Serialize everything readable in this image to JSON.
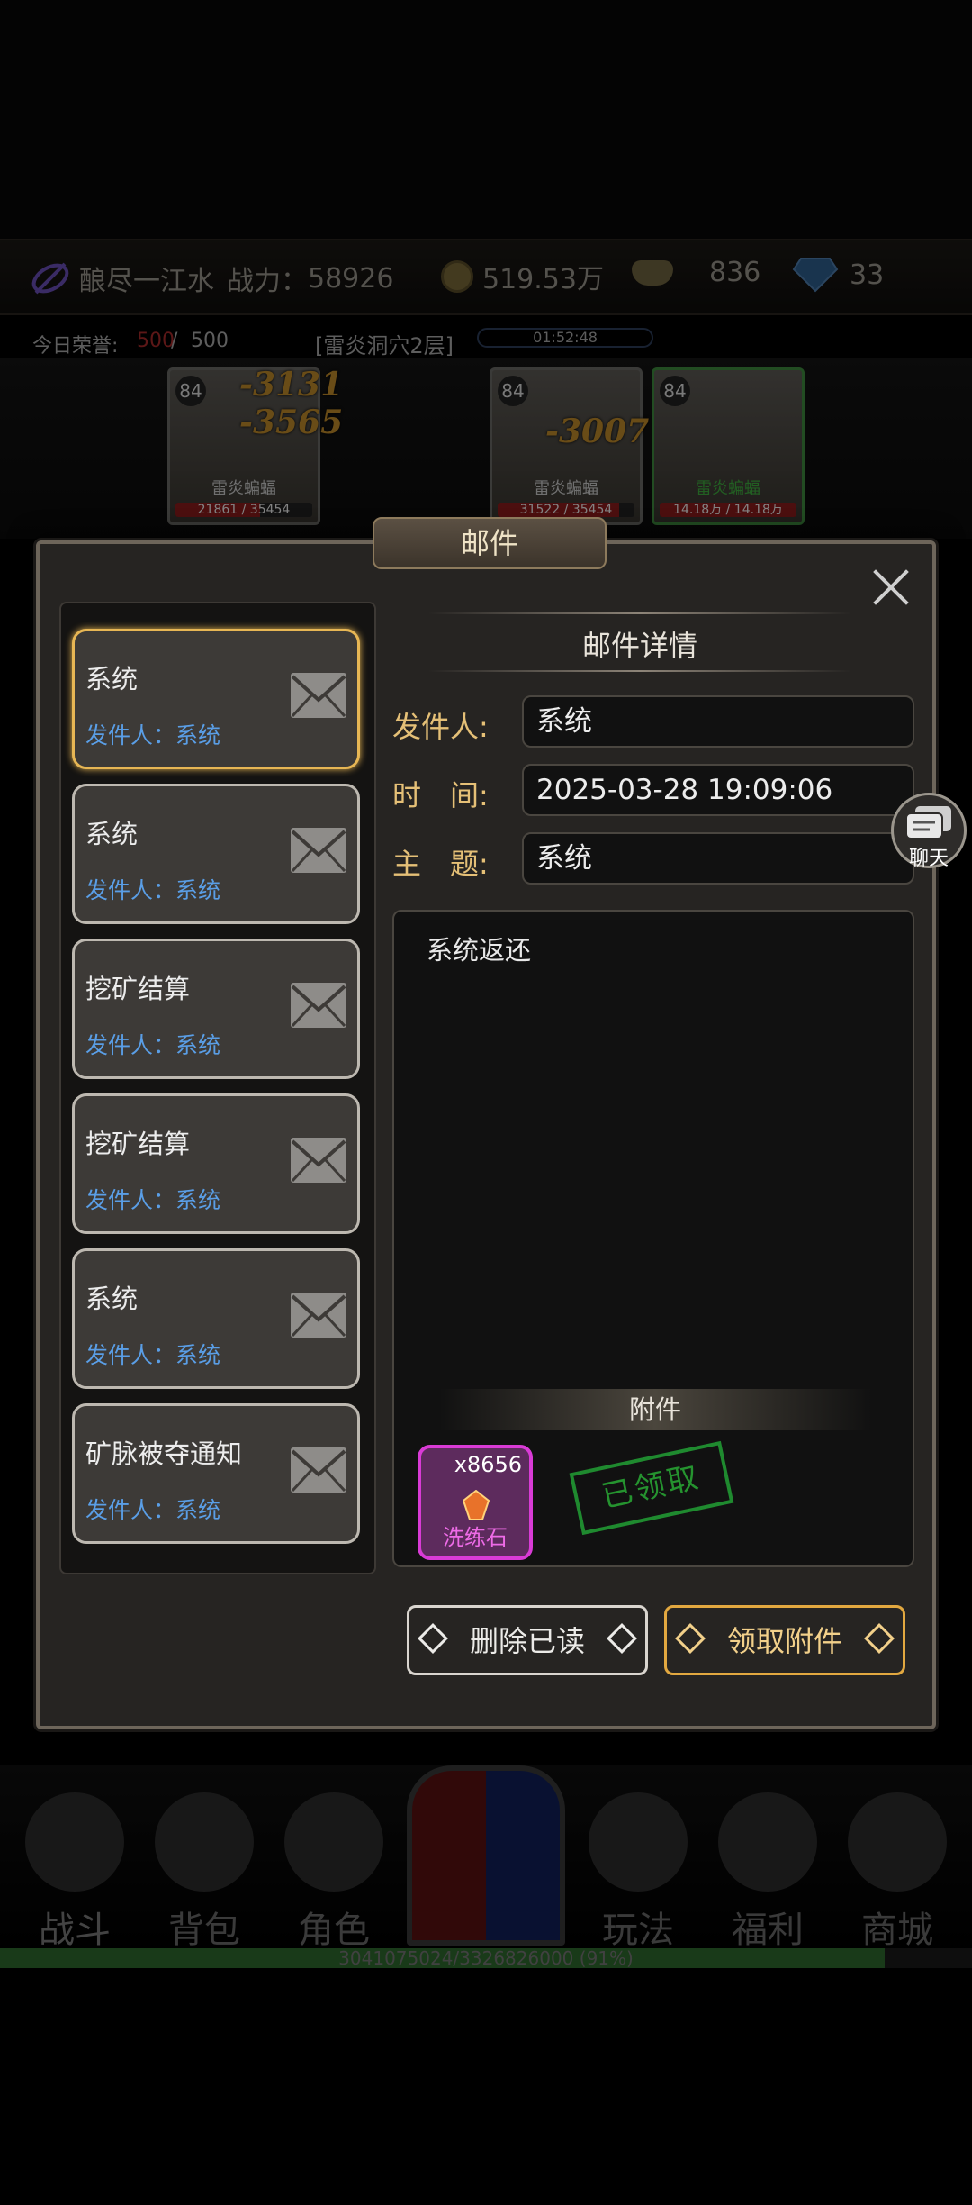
{
  "topbar": {
    "player_name": "酿尽一江水",
    "power_label": "战力：",
    "power_value": "58926",
    "gold": "519.53万",
    "ingot": "836",
    "diamond": "33"
  },
  "honor": {
    "label": "今日荣誉:",
    "current": "500",
    "sep": " / ",
    "max": "500",
    "location": "[雷炎洞穴2层]",
    "timer": "01:52:48"
  },
  "monsters": [
    {
      "level": "84",
      "name": "雷炎蝙蝠",
      "hp": "21861 / 35454",
      "hp_ratio": 0.62
    },
    {
      "level": "84",
      "name": "雷炎蝙蝠",
      "hp": "31522 / 35454",
      "hp_ratio": 0.89
    },
    {
      "level": "84",
      "name": "雷炎蝙蝠",
      "hp": "14.18万 / 14.18万",
      "hp_ratio": 1.0
    }
  ],
  "damage_numbers": [
    "-3131",
    "-3565",
    "-3007"
  ],
  "dialog": {
    "title": "邮件",
    "detail_title": "邮件详情",
    "fields": {
      "sender_label": "发件人:",
      "sender_value": "系统",
      "time_label": "时　间:",
      "time_value": "2025-03-28 19:09:06",
      "subject_label": "主　题:",
      "subject_value": "系统"
    },
    "content": "系统返还",
    "attachment_header": "附件",
    "attachment": {
      "count": "x8656",
      "name": "洗练石"
    },
    "stamp": "已领取",
    "delete_read_label": "删除已读",
    "claim_label": "领取附件"
  },
  "mail_list": [
    {
      "title": "系统",
      "sender": "发件人：系统",
      "selected": true
    },
    {
      "title": "系统",
      "sender": "发件人：系统",
      "selected": false
    },
    {
      "title": "挖矿结算",
      "sender": "发件人：系统",
      "selected": false
    },
    {
      "title": "挖矿结算",
      "sender": "发件人：系统",
      "selected": false
    },
    {
      "title": "系统",
      "sender": "发件人：系统",
      "selected": false
    },
    {
      "title": "矿脉被夺通知",
      "sender": "发件人：系统",
      "selected": false
    }
  ],
  "chat_label": "聊天",
  "nav": [
    "战斗",
    "背包",
    "角色",
    "玩法",
    "福利",
    "商城"
  ],
  "exp": {
    "text": "3041075024/3326826000 (91%)",
    "ratio": 0.91
  },
  "colors": {
    "accent_gold": "#e7b654",
    "sender_blue": "#5a9ee6",
    "attachment_purple": "#d93bd6",
    "stamp_green": "#25932f"
  }
}
